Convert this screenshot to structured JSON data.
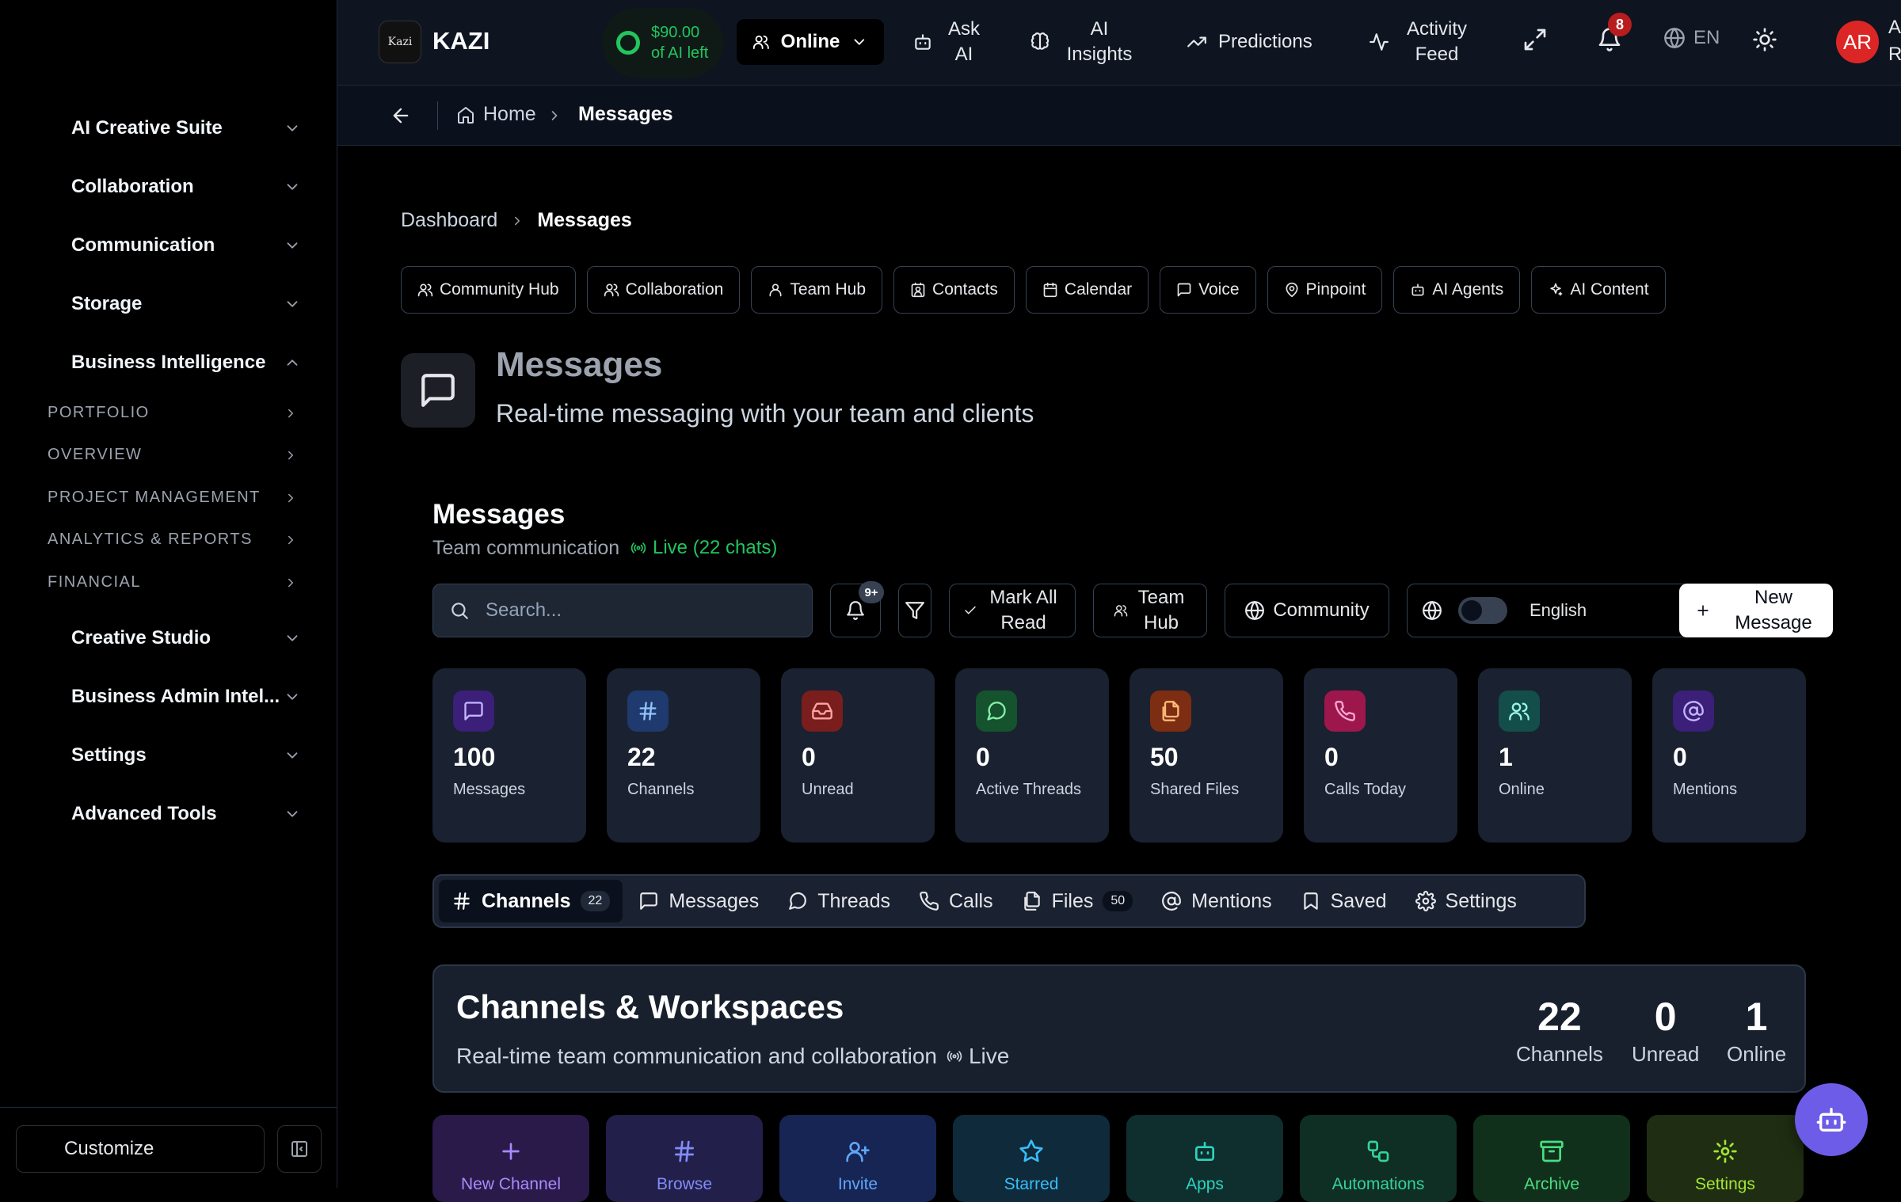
{
  "sidebar": {
    "groups": [
      {
        "label": "AI Creative Suite"
      },
      {
        "label": "Collaboration"
      },
      {
        "label": "Communication"
      },
      {
        "label": "Storage"
      },
      {
        "label": "Business Intelligence"
      },
      {
        "label": "Creative Studio"
      },
      {
        "label": "Business Admin Intel..."
      },
      {
        "label": "Settings"
      },
      {
        "label": "Advanced Tools"
      }
    ],
    "sub_items": [
      "PORTFOLIO",
      "OVERVIEW",
      "PROJECT MANAGEMENT",
      "ANALYTICS & REPORTS",
      "FINANCIAL"
    ],
    "customize_label": "Customize"
  },
  "topbar": {
    "logo_text": "Kazi",
    "brand": "KAZI",
    "credit": "$90.00 of AI left",
    "status": "Online",
    "ask_ai": "Ask AI",
    "ai_insights": "AI Insights",
    "predictions": "Predictions",
    "activity_feed": "Activity Feed",
    "notifications_count": "8",
    "language": "EN",
    "avatar_initials": "AR",
    "user_name_cut": "A R"
  },
  "breadcrumb": {
    "home": "Home",
    "current": "Messages"
  },
  "page_crumb": {
    "root": "Dashboard",
    "current": "Messages"
  },
  "quick_links": [
    "Community Hub",
    "Collaboration",
    "Team Hub",
    "Contacts",
    "Calendar",
    "Voice",
    "Pinpoint",
    "AI Agents",
    "AI Content"
  ],
  "hero": {
    "title": "Messages",
    "subtitle": "Real-time messaging with your team and clients"
  },
  "messages_section": {
    "title": "Messages",
    "subtitle": "Team communication",
    "live": "Live (22 chats)"
  },
  "toolbar": {
    "search_placeholder": "Search...",
    "notif_badge": "9+",
    "mark_all_read": "Mark All Read",
    "team_hub": "Team Hub",
    "community": "Community",
    "language_select": "English",
    "new_message": "New Message"
  },
  "stats": [
    {
      "value": "100",
      "label": "Messages",
      "icon": "message-square-icon",
      "color": "#6d28d9"
    },
    {
      "value": "22",
      "label": "Channels",
      "icon": "hash-icon",
      "color": "#1d4ed8"
    },
    {
      "value": "0",
      "label": "Unread",
      "icon": "inbox-icon",
      "color": "#b91c1c"
    },
    {
      "value": "0",
      "label": "Active Threads",
      "icon": "message-circle-icon",
      "color": "#15803d"
    },
    {
      "value": "50",
      "label": "Shared Files",
      "icon": "files-icon",
      "color": "#c2410c"
    },
    {
      "value": "0",
      "label": "Calls Today",
      "icon": "phone-icon",
      "color": "#db2777"
    },
    {
      "value": "1",
      "label": "Online",
      "icon": "users-icon",
      "color": "#0f766e"
    },
    {
      "value": "0",
      "label": "Mentions",
      "icon": "at-sign-icon",
      "color": "#6d28d9"
    }
  ],
  "tabs": [
    {
      "label": "Channels",
      "count": "22",
      "active": true
    },
    {
      "label": "Messages"
    },
    {
      "label": "Threads"
    },
    {
      "label": "Calls"
    },
    {
      "label": "Files",
      "count": "50"
    },
    {
      "label": "Mentions"
    },
    {
      "label": "Saved"
    },
    {
      "label": "Settings"
    }
  ],
  "channels_panel": {
    "title": "Channels & Workspaces",
    "subtitle": "Real-time team communication and collaboration",
    "live": "Live",
    "stats": [
      {
        "value": "22",
        "label": "Channels"
      },
      {
        "value": "0",
        "label": "Unread"
      },
      {
        "value": "1",
        "label": "Online"
      }
    ]
  },
  "actions": [
    {
      "label": "New Channel",
      "color": "#a78bfa"
    },
    {
      "label": "Browse",
      "color": "#818cf8"
    },
    {
      "label": "Invite",
      "color": "#60a5fa"
    },
    {
      "label": "Starred",
      "color": "#38bdf8"
    },
    {
      "label": "Apps",
      "color": "#2dd4bf"
    },
    {
      "label": "Automations",
      "color": "#34d399"
    },
    {
      "label": "Archive",
      "color": "#4ade80"
    },
    {
      "label": "Settings",
      "color": "#a3e635"
    }
  ]
}
